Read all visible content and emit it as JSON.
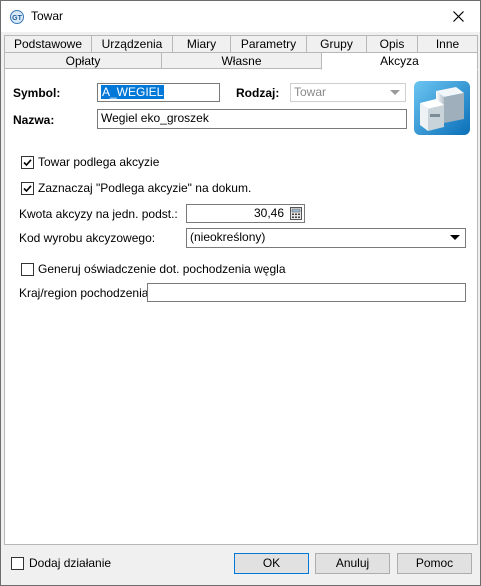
{
  "window": {
    "title": "Towar"
  },
  "tabs": {
    "row1": [
      "Podstawowe",
      "Urządzenia",
      "Miary",
      "Parametry",
      "Grupy",
      "Opis",
      "Inne"
    ],
    "row2": [
      "Opłaty",
      "Własne",
      "Akcyza"
    ],
    "active": "Akcyza"
  },
  "form": {
    "symbol_label": "Symbol:",
    "symbol_value": "A_WEGIEL",
    "rodzaj_label": "Rodzaj:",
    "rodzaj_value": "Towar",
    "nazwa_label": "Nazwa:",
    "nazwa_value": "Wegiel eko_groszek"
  },
  "akcyza": {
    "podlega_label": "Towar podlega akcyzie",
    "podlega_checked": true,
    "zaznaczaj_label": "Zaznaczaj \"Podlega akcyzie\" na dokum.",
    "zaznaczaj_checked": true,
    "kwota_label": "Kwota akcyzy na jedn. podst.:",
    "kwota_value": "30,46",
    "kod_label": "Kod wyrobu akcyzowego:",
    "kod_value": "(nieokreślony)",
    "generuj_label": "Generuj oświadczenie dot. pochodzenia węgla",
    "generuj_checked": false,
    "kraj_label": "Kraj/region pochodzenia:",
    "kraj_value": ""
  },
  "footer": {
    "dodaj_label": "Dodaj działanie",
    "dodaj_checked": false,
    "ok_label": "OK",
    "cancel_label": "Anuluj",
    "help_label": "Pomoc"
  },
  "icons": [
    "app-icon",
    "close-icon",
    "product-boxes-icon",
    "calculator-icon",
    "dropdown-arrow-icon",
    "checkmark-icon"
  ]
}
